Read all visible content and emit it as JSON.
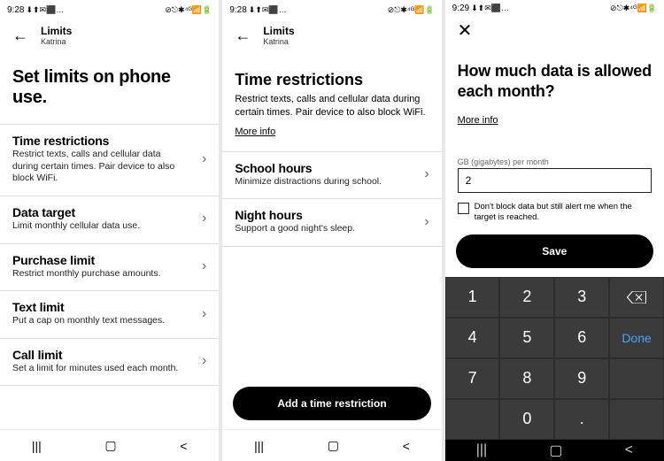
{
  "status": {
    "time1": "9:28",
    "time2": "9:28",
    "time3": "9:29",
    "icons_left": "⬇⬆✉⬛…",
    "icons_right": "⊘⎋✱⁴ᴳ📶🔋"
  },
  "screen1": {
    "header_title": "Limits",
    "header_sub": "Katrina",
    "page_title": "Set limits on phone use.",
    "rows": [
      {
        "title": "Time restrictions",
        "sub": "Restrict texts, calls and cellular data during certain times. Pair device to also block WiFi."
      },
      {
        "title": "Data target",
        "sub": "Limit monthly cellular data use."
      },
      {
        "title": "Purchase limit",
        "sub": "Restrict monthly purchase amounts."
      },
      {
        "title": "Text limit",
        "sub": "Put a cap on monthly text messages."
      },
      {
        "title": "Call limit",
        "sub": "Set a limit for minutes used each month."
      }
    ]
  },
  "screen2": {
    "header_title": "Limits",
    "header_sub": "Katrina",
    "page_title": "Time restrictions",
    "page_sub": "Restrict texts, calls and cellular data during certain times. Pair device to also block WiFi.",
    "more_info": "More info",
    "rows": [
      {
        "title": "School hours",
        "sub": "Minimize distractions during school."
      },
      {
        "title": "Night hours",
        "sub": "Support a good night's sleep."
      }
    ],
    "button": "Add a time restriction"
  },
  "screen3": {
    "question": "How much data is allowed each month?",
    "more_info": "More info",
    "field_label": "GB (gigabytes) per month",
    "input_value": "2",
    "checkbox_label": "Don't block data but still alert me when the target is reached.",
    "save": "Save",
    "keys": [
      [
        "1",
        "2",
        "3",
        "bsp"
      ],
      [
        "4",
        "5",
        "6",
        "Done"
      ],
      [
        "7",
        "8",
        "9",
        ""
      ],
      [
        "",
        "0",
        ".",
        ""
      ]
    ]
  },
  "nav": {
    "recent": "|||",
    "home": "▢",
    "back": "<"
  }
}
